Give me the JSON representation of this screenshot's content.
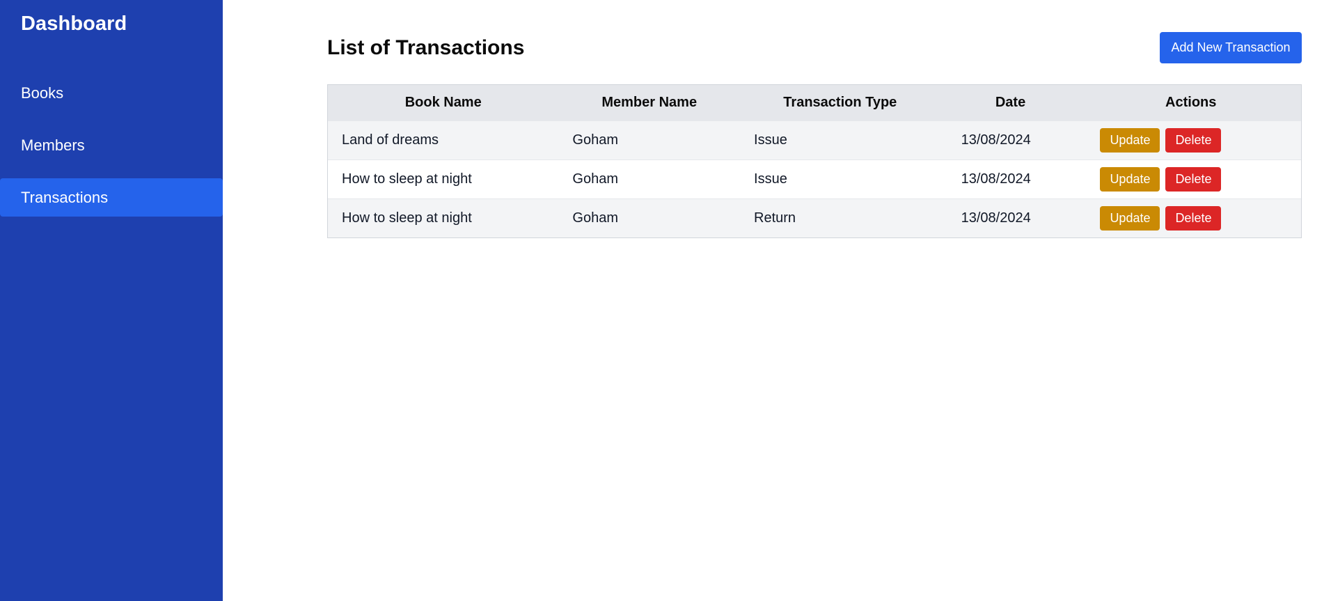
{
  "sidebar": {
    "title": "Dashboard",
    "items": [
      {
        "label": "Books"
      },
      {
        "label": "Members"
      },
      {
        "label": "Transactions"
      }
    ]
  },
  "main": {
    "title": "List of Transactions",
    "add_button_label": "Add New Transaction",
    "table": {
      "headers": [
        "Book Name",
        "Member Name",
        "Transaction Type",
        "Date",
        "Actions"
      ],
      "rows": [
        {
          "book": "Land of dreams",
          "member": "Goham",
          "type": "Issue",
          "date": "13/08/2024",
          "update_label": "Update",
          "delete_label": "Delete"
        },
        {
          "book": "How to sleep at night",
          "member": "Goham",
          "type": "Issue",
          "date": "13/08/2024",
          "update_label": "Update",
          "delete_label": "Delete"
        },
        {
          "book": "How to sleep at night",
          "member": "Goham",
          "type": "Return",
          "date": "13/08/2024",
          "update_label": "Update",
          "delete_label": "Delete"
        }
      ]
    }
  },
  "colors": {
    "sidebar_bg": "#1e40af",
    "active_item_bg": "#2563eb",
    "primary_button": "#2563eb",
    "update_button": "#ca8a04",
    "delete_button": "#dc2626"
  }
}
